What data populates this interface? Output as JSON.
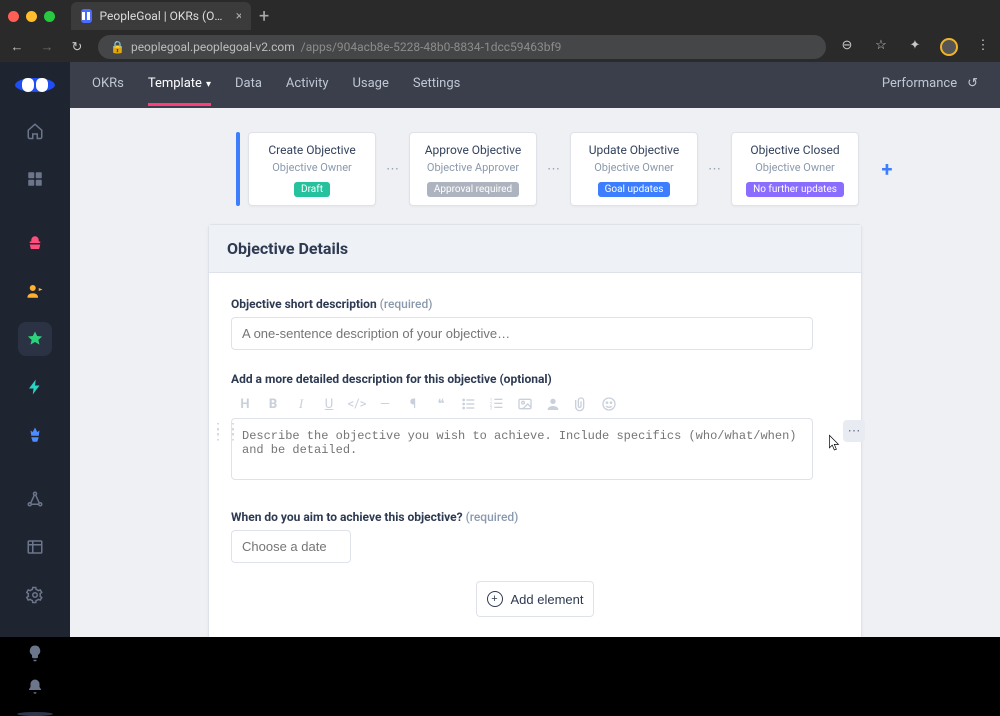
{
  "browser": {
    "tab_title": "PeopleGoal | OKRs (Objectives…",
    "url_host": "peoplegoal.peoplegoal-v2.com",
    "url_path": "/apps/904acb8e-5228-48b0-8834-1dcc59463bf9"
  },
  "topnav": {
    "items": [
      "OKRs",
      "Template",
      "Data",
      "Activity",
      "Usage",
      "Settings"
    ],
    "active_index": 1,
    "right_label": "Performance"
  },
  "workflow": {
    "steps": [
      {
        "title": "Create Objective",
        "subtitle": "Objective Owner",
        "badge": "Draft",
        "badge_style": "teal"
      },
      {
        "title": "Approve Objective",
        "subtitle": "Objective Approver",
        "badge": "Approval required",
        "badge_style": "grey"
      },
      {
        "title": "Update Objective",
        "subtitle": "Objective Owner",
        "badge": "Goal updates",
        "badge_style": "blue"
      },
      {
        "title": "Objective Closed",
        "subtitle": "Objective Owner",
        "badge": "No further updates",
        "badge_style": "purple"
      }
    ]
  },
  "form": {
    "heading": "Objective Details",
    "short_desc": {
      "label": "Objective short description",
      "required_text": "(required)",
      "placeholder": "A one-sentence description of your objective…"
    },
    "long_desc": {
      "label": "Add a more detailed description for this objective (optional)",
      "placeholder": "Describe the objective you wish to achieve. Include specifics (who/what/when) and be detailed."
    },
    "due_date": {
      "label": "When do you aim to achieve this objective?",
      "required_text": "(required)",
      "placeholder": "Choose a date"
    },
    "add_element": "Add element"
  }
}
